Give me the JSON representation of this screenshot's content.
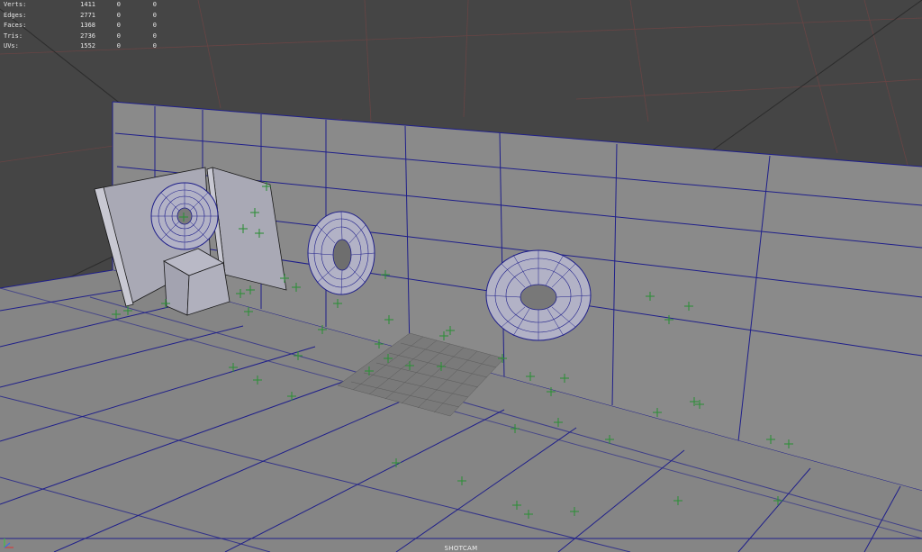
{
  "hud": {
    "rows": [
      {
        "label": "Verts:",
        "v1": "1411",
        "v2": "0",
        "v3": "0"
      },
      {
        "label": "Edges:",
        "v1": "2771",
        "v2": "0",
        "v3": "0"
      },
      {
        "label": "Faces:",
        "v1": "1368",
        "v2": "0",
        "v3": "0"
      },
      {
        "label": "Tris:",
        "v1": "2736",
        "v2": "0",
        "v3": "0"
      },
      {
        "label": "UVs:",
        "v1": "1552",
        "v2": "0",
        "v3": "0"
      }
    ]
  },
  "viewport": {
    "camera_label": "SHOTCAM"
  },
  "colors": {
    "background": "#454545",
    "wireframe": "#1f1f8a",
    "geometry": "#8e8e8e",
    "selected_geometry": "#a9a9bd",
    "grid_red": "#7a4b4b",
    "marker_green": "#2f8f3a"
  },
  "icons": {
    "axis_gizmo": "axis-gizmo-icon",
    "marker": "plus-marker-icon"
  }
}
